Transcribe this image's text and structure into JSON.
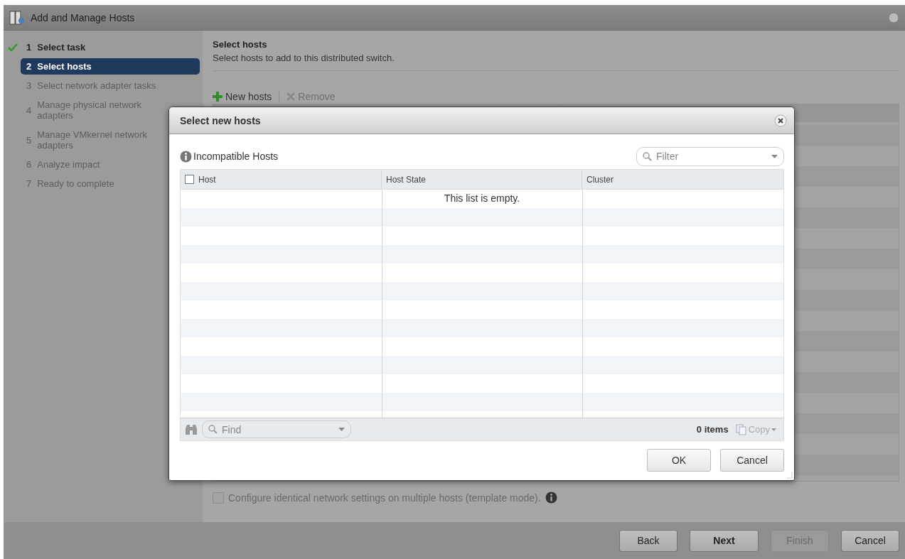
{
  "window": {
    "title": "Add and Manage Hosts"
  },
  "steps": [
    {
      "number": "1",
      "label": "Select task",
      "kind": "done",
      "selected": false
    },
    {
      "number": "2",
      "label": "Select hosts",
      "kind": "current",
      "selected": true
    },
    {
      "number": "3",
      "label": "Select network adapter tasks",
      "kind": "pending",
      "selected": false
    },
    {
      "number": "4",
      "label": "Manage physical network adapters",
      "kind": "pending",
      "selected": false
    },
    {
      "number": "5",
      "label": "Manage VMkernel network adapters",
      "kind": "pending",
      "selected": false
    },
    {
      "number": "6",
      "label": "Analyze impact",
      "kind": "pending",
      "selected": false
    },
    {
      "number": "7",
      "label": "Ready to complete",
      "kind": "pending",
      "selected": false
    }
  ],
  "page": {
    "heading": "Select hosts",
    "subtitle": "Select hosts to add to this distributed switch.",
    "toolbar": [
      {
        "label": "New hosts",
        "kind": "add",
        "disabled": false
      },
      {
        "label": "Remove",
        "kind": "remove",
        "disabled": true
      }
    ],
    "template_mode": {
      "label": "Configure identical network settings on multiple hosts (template mode).",
      "checked": false
    }
  },
  "dialog": {
    "title": "Select new hosts",
    "section": "Incompatible Hosts",
    "filter": {
      "placeholder": "Filter"
    },
    "table": {
      "select_all_checked": false,
      "columns": [
        "Host",
        "Host State",
        "Cluster"
      ],
      "empty_message": "This list is empty."
    },
    "find": {
      "placeholder": "Find"
    },
    "item_count": "0 items",
    "copy": "Copy",
    "buttons": [
      {
        "label": "OK"
      },
      {
        "label": "Cancel"
      }
    ]
  },
  "footer_buttons": [
    {
      "label": "Back",
      "primary": false,
      "disabled": false
    },
    {
      "label": "Next",
      "primary": true,
      "disabled": false
    },
    {
      "label": "Finish",
      "primary": false,
      "disabled": true
    },
    {
      "label": "Cancel",
      "primary": false,
      "disabled": false
    }
  ]
}
